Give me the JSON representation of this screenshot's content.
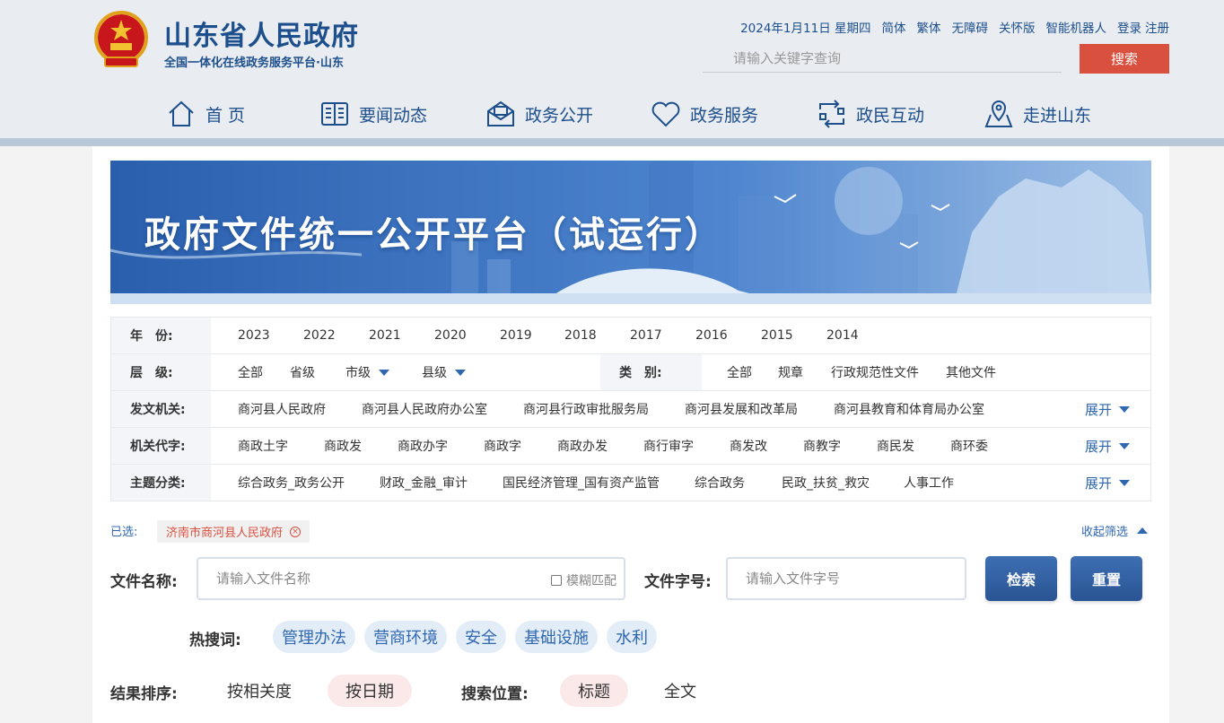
{
  "header": {
    "title": "山东省人民政府",
    "subtitle": "全国一体化在线政务服务平台·山东",
    "date": "2024年1月11日 星期四",
    "links": [
      "简体",
      "繁体",
      "无障碍",
      "关怀版",
      "智能机器人",
      "登录",
      "注册"
    ],
    "search_placeholder": "请输入关键字查询",
    "search_button": "搜索"
  },
  "nav": [
    {
      "label": "首 页",
      "icon": "home-icon"
    },
    {
      "label": "要闻动态",
      "icon": "newspaper-icon"
    },
    {
      "label": "政务公开",
      "icon": "mail-icon"
    },
    {
      "label": "政务服务",
      "icon": "heart-icon"
    },
    {
      "label": "政民互动",
      "icon": "exchange-icon"
    },
    {
      "label": "走进山东",
      "icon": "map-pin-icon"
    }
  ],
  "banner": {
    "title": "政府文件统一公开平台（试运行）"
  },
  "filters": {
    "year": {
      "label": "年　份:",
      "items": [
        "2023",
        "2022",
        "2021",
        "2020",
        "2019",
        "2018",
        "2017",
        "2016",
        "2015",
        "2014"
      ]
    },
    "level": {
      "label": "层　级:",
      "items": [
        "全部",
        "省级",
        "市级",
        "县级"
      ]
    },
    "category": {
      "label": "类　别:",
      "items": [
        "全部",
        "规章",
        "行政规范性文件",
        "其他文件"
      ]
    },
    "issuer": {
      "label": "发文机关:",
      "items": [
        "商河县人民政府",
        "商河县人民政府办公室",
        "商河县行政审批服务局",
        "商河县发展和改革局",
        "商河县教育和体育局办公室"
      ],
      "expand": "展开"
    },
    "code": {
      "label": "机关代字:",
      "items": [
        "商政土字",
        "商政发",
        "商政办字",
        "商政字",
        "商政办发",
        "商行审字",
        "商发改",
        "商教字",
        "商民发",
        "商环委"
      ],
      "expand": "展开"
    },
    "topic": {
      "label": "主题分类:",
      "items": [
        "综合政务_政务公开",
        "财政_金融_审计",
        "国民经济管理_国有资产监管",
        "综合政务",
        "民政_扶贫_救灾",
        "人事工作"
      ],
      "expand": "展开"
    }
  },
  "selected": {
    "label": "已选:",
    "chip": "济南市商河县人民政府",
    "collapse": "收起筛选"
  },
  "search": {
    "name_label": "文件名称:",
    "name_placeholder": "请输入文件名称",
    "fuzzy": "模糊匹配",
    "code_label": "文件字号:",
    "code_placeholder": "请输入文件字号",
    "search_button": "检索",
    "reset_button": "重置"
  },
  "hot": {
    "label": "热搜词:",
    "items": [
      "管理办法",
      "营商环境",
      "安全",
      "基础设施",
      "水利"
    ]
  },
  "sort": {
    "label": "结果排序:",
    "options": [
      "按相关度",
      "按日期"
    ],
    "active": "按日期"
  },
  "position": {
    "label": "搜索位置:",
    "options": [
      "标题",
      "全文"
    ],
    "active": "标题"
  },
  "colors": {
    "primary": "#1d4f8c",
    "accent": "#d9503f",
    "link": "#2f67b1"
  }
}
